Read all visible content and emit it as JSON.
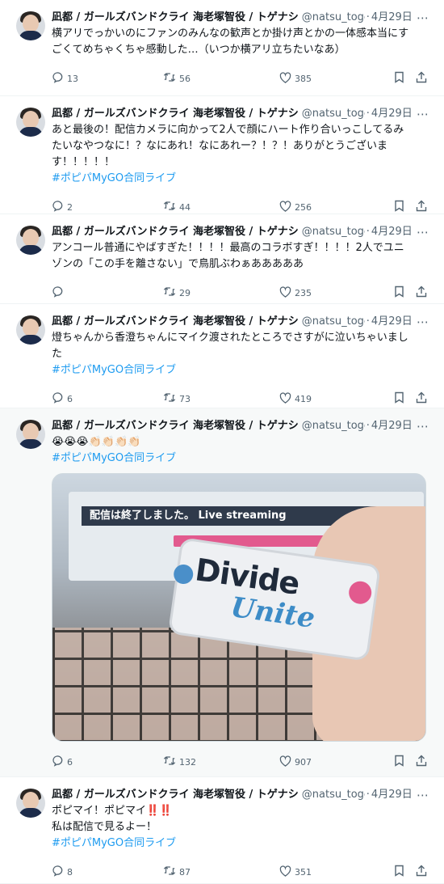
{
  "colors": {
    "link": "#1d9bf0",
    "muted": "#536471",
    "text": "#0f1419",
    "divider": "#eff3f4"
  },
  "tweets": [
    {
      "name": "凪都 / ガールズバンドクライ 海老塚智役 / トゲナシ",
      "handle": "@natsu_toge",
      "date": "4月29日",
      "text": "横アリでっかいのにファンのみんなの歓声とか掛け声とかの一体感本当にすごくてめちゃくちゃ感動した…（いつか横アリ立ちたいなあ）",
      "hashtag": "",
      "replies": "13",
      "retweets": "56",
      "likes": "385"
    },
    {
      "name": "凪都 / ガールズバンドクライ 海老塚智役 / トゲナシ",
      "handle": "@natsu_toge",
      "date": "4月29日",
      "text": "あと最後の！配信カメラに向かって2人で顔にハート作り合いっこしてるみたいなやつなに！？なにあれ！なにあれー？！？！ありがとうございます！！！！！",
      "hashtag": "#ポピパMyGO合同ライブ",
      "replies": "2",
      "retweets": "44",
      "likes": "256"
    },
    {
      "name": "凪都 / ガールズバンドクライ 海老塚智役 / トゲナシ",
      "handle": "@natsu_toge",
      "date": "4月29日",
      "text": "アンコール普通にやばすぎた！！！！最高のコラボすぎ！！！！2人でユニゾンの「この手を離さない」で鳥肌ぶわぁあああああ",
      "hashtag": "",
      "replies": "",
      "retweets": "29",
      "likes": "235"
    },
    {
      "name": "凪都 / ガールズバンドクライ 海老塚智役 / トゲナシ",
      "handle": "@natsu_toge",
      "date": "4月29日",
      "text": "燈ちゃんから香澄ちゃんにマイク渡されたところでさすがに泣いちゃいました",
      "hashtag": "#ポピパMyGO合同ライブ",
      "replies": "6",
      "retweets": "73",
      "likes": "419"
    },
    {
      "name": "凪都 / ガールズバンドクライ 海老塚智役 / トゲナシ",
      "handle": "@natsu_toge",
      "date": "4月29日",
      "text": "😭😭😭👏🏻👏🏻👏🏻👏🏻",
      "hashtag": "#ポピパMyGO合同ライブ",
      "media": {
        "banner": "配信は終了しました。 Live streaming",
        "word1": "Divide",
        "word2": "Unite"
      },
      "replies": "6",
      "retweets": "132",
      "likes": "907"
    },
    {
      "name": "凪都 / ガールズバンドクライ 海老塚智役 / トゲナシ",
      "handle": "@natsu_toge",
      "date": "4月29日",
      "text": "ポピマイ！ポピマイ‼️‼️\n私は配信で見るよー！",
      "hashtag": "#ポピパMyGO合同ライブ",
      "replies": "8",
      "retweets": "87",
      "likes": "351"
    }
  ],
  "icons": {
    "reply": "reply-icon",
    "retweet": "retweet-icon",
    "like": "heart-icon",
    "bookmark": "bookmark-icon",
    "share": "share-icon",
    "more": "more-icon"
  }
}
